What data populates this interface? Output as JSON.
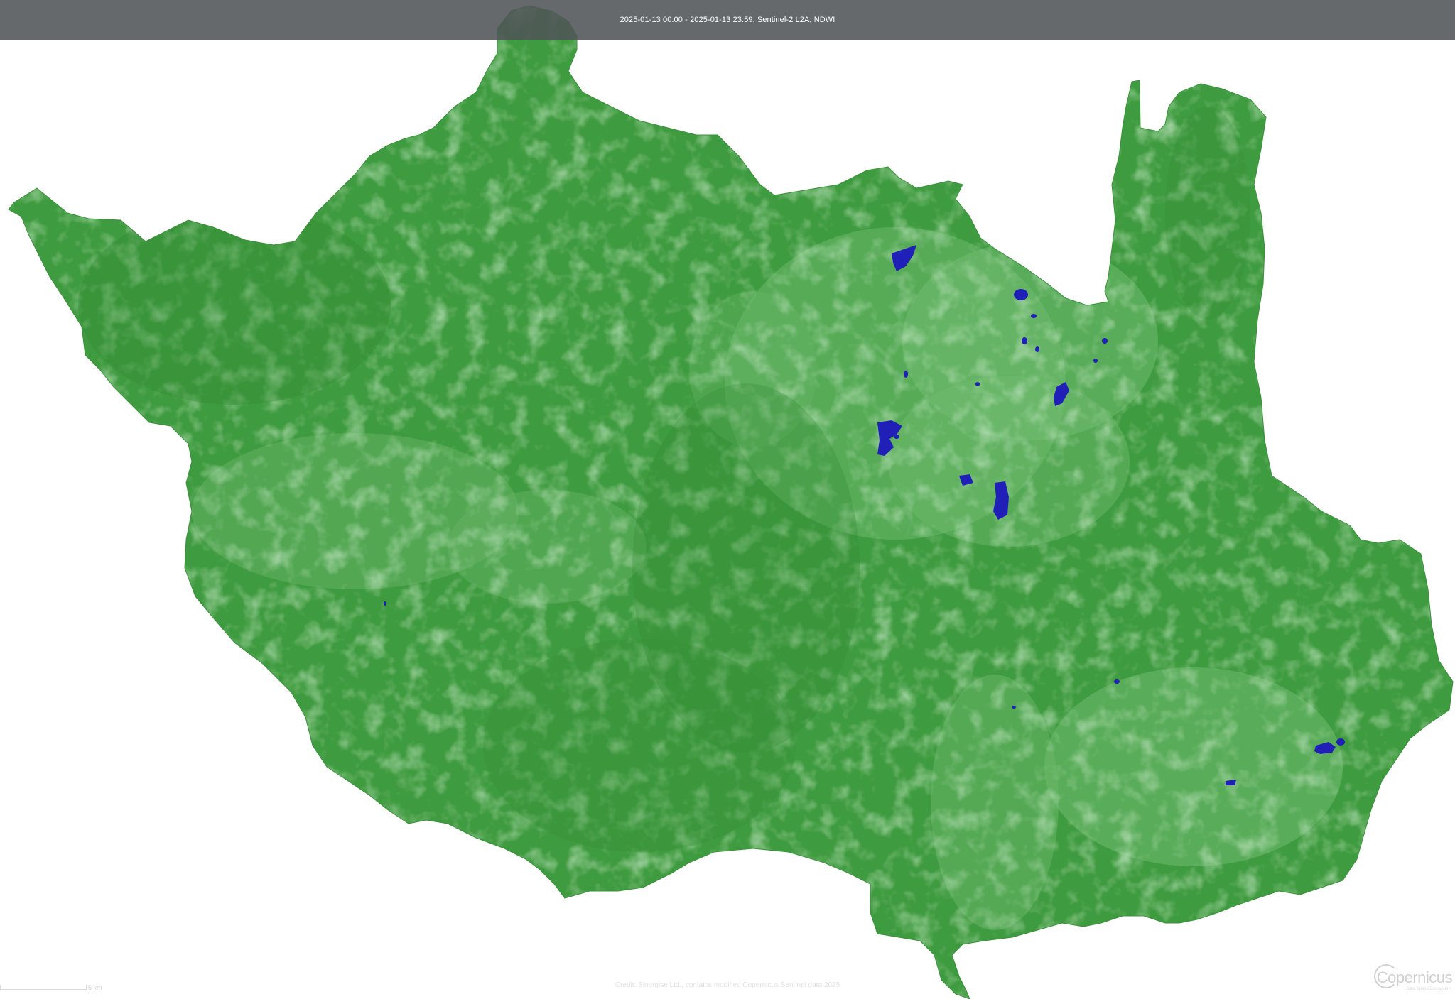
{
  "header": {
    "title": "2025-01-13 00:00 - 2025-01-13 23:59, Sentinel-2 L2A, NDWI"
  },
  "map": {
    "land_color": "#3f9b3f",
    "land_light_color": "#8cc98c",
    "water_color": "#2020b8",
    "background_color": "#ffffff"
  },
  "scale": {
    "label": "5 km"
  },
  "footer": {
    "credit": "Credit: Sinergise Ltd., contains modified Copernicus Sentinel data 2025"
  },
  "logo": {
    "wordmark": "Copernicus",
    "tagline": "Data Space Ecosystem",
    "icon": "copernicus-logo"
  }
}
